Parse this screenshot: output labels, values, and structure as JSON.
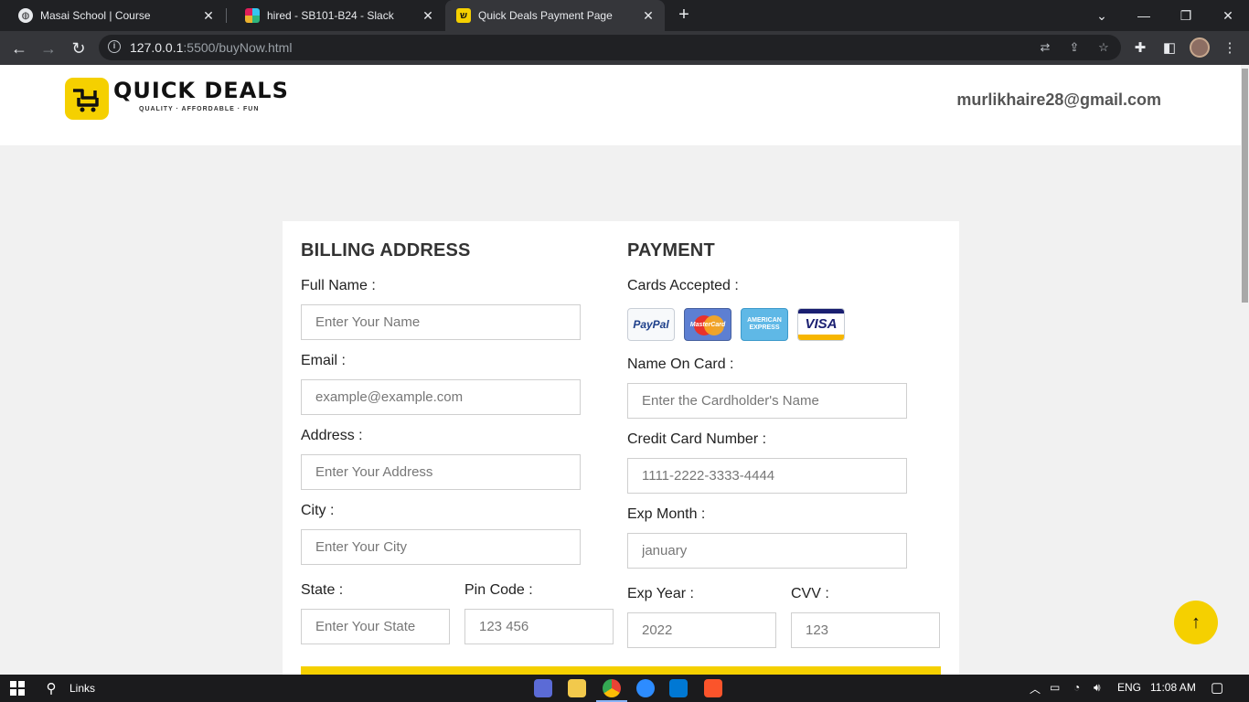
{
  "browser": {
    "tabs": [
      {
        "title": "Masai School | Course",
        "favicon": "globe-icon"
      },
      {
        "title": "hired - SB101-B24 - Slack",
        "favicon": "slack-icon"
      },
      {
        "title": "Quick Deals Payment Page",
        "favicon": "quick-deals-icon",
        "active": true
      }
    ],
    "new_tab": "+",
    "url_host": "127.0.0.1",
    "url_rest": ":5500/buyNow.html"
  },
  "site": {
    "logo_text": "QUICK DEALS",
    "logo_tagline": "QUALITY · AFFORDABLE · FUN",
    "user_email": "murlikhaire28@gmail.com"
  },
  "billing": {
    "title": "BILLING ADDRESS",
    "full_name_label": "Full Name :",
    "full_name_placeholder": "Enter Your Name",
    "email_label": "Email :",
    "email_placeholder": "example@example.com",
    "address_label": "Address :",
    "address_placeholder": "Enter Your Address",
    "city_label": "City :",
    "city_placeholder": "Enter Your City",
    "state_label": "State :",
    "state_placeholder": "Enter Your State",
    "pin_label": "Pin Code :",
    "pin_placeholder": "123 456"
  },
  "payment": {
    "title": "PAYMENT",
    "cards_label": "Cards Accepted :",
    "cards": {
      "paypal": "PayPal",
      "mastercard": "MasterCard",
      "amex": "AMERICAN EXPRESS",
      "visa": "VISA"
    },
    "name_on_card_label": "Name On Card :",
    "name_on_card_placeholder": "Enter the Cardholder's Name",
    "card_number_label": "Credit Card Number :",
    "card_number_placeholder": "1111-2222-3333-4444",
    "exp_month_label": "Exp Month :",
    "exp_month_placeholder": "january",
    "exp_year_label": "Exp Year :",
    "exp_year_placeholder": "2022",
    "cvv_label": "CVV :",
    "cvv_placeholder": "123"
  },
  "taskbar": {
    "search_label": "Links",
    "language": "ENG",
    "time": "11:08 AM"
  },
  "colors": {
    "accent": "#f5d000",
    "chrome_dark": "#202124",
    "page_bg": "#f1f1f1"
  }
}
